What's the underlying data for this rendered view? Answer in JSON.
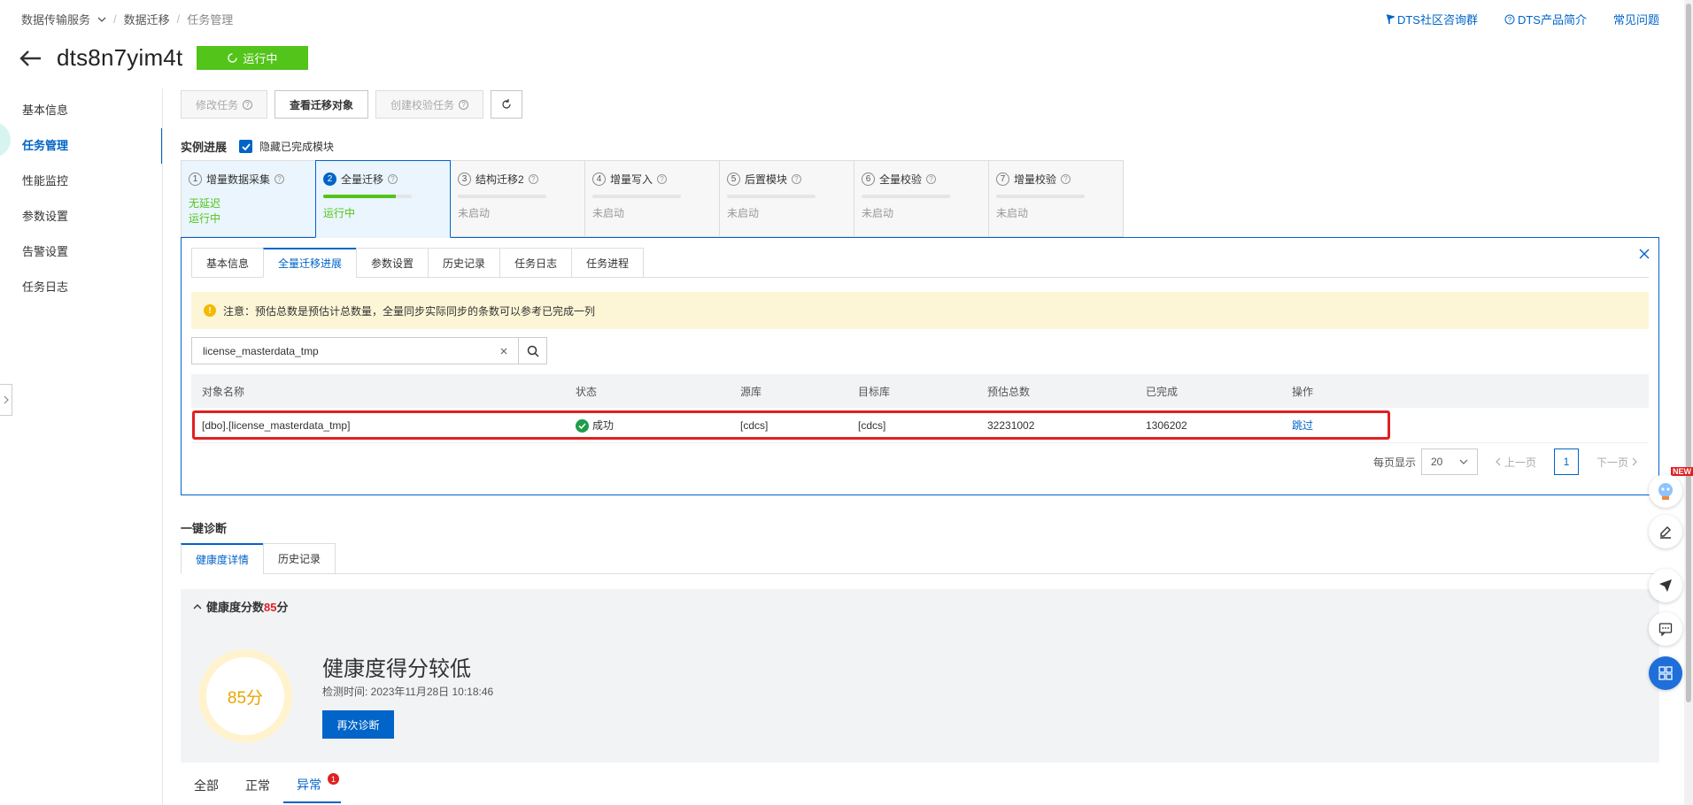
{
  "breadcrumb": {
    "service": "数据传输服务",
    "migrate": "数据迁移",
    "current": "任务管理"
  },
  "top_links": {
    "community": "DTS社区咨询群",
    "intro": "DTS产品简介",
    "faq": "常见问题"
  },
  "header": {
    "title": "dts8n7yim4t",
    "status": "运行中"
  },
  "sidenav": {
    "items": [
      "基本信息",
      "任务管理",
      "性能监控",
      "参数设置",
      "告警设置",
      "任务日志"
    ]
  },
  "toolbar": {
    "modify": "修改任务",
    "view_objects": "查看迁移对象",
    "create_check": "创建校验任务"
  },
  "progress": {
    "label": "实例进展",
    "hide_done": "隐藏已完成模块"
  },
  "steps": [
    {
      "num": "1",
      "name": "增量数据采集",
      "line1": "无延迟",
      "line2": "运行中"
    },
    {
      "num": "2",
      "name": "全量迁移",
      "progress": 0.82,
      "line2": "运行中"
    },
    {
      "num": "3",
      "name": "结构迁移2",
      "status": "未启动"
    },
    {
      "num": "4",
      "name": "增量写入",
      "status": "未启动"
    },
    {
      "num": "5",
      "name": "后置模块",
      "status": "未启动"
    },
    {
      "num": "6",
      "name": "全量校验",
      "status": "未启动"
    },
    {
      "num": "7",
      "name": "增量校验",
      "status": "未启动"
    }
  ],
  "panel": {
    "tabs": [
      "基本信息",
      "全量迁移进展",
      "参数设置",
      "历史记录",
      "任务日志",
      "任务进程"
    ],
    "notice": "注意：预估总数是预估计总数量，全量同步实际同步的条数可以参考已完成一列",
    "search_value": "license_masterdata_tmp",
    "columns": [
      "对象名称",
      "状态",
      "源库",
      "目标库",
      "预估总数",
      "已完成",
      "操作"
    ],
    "row": {
      "name": "[dbo].[license_masterdata_tmp]",
      "status": "成功",
      "source": "[cdcs]",
      "target": "[cdcs]",
      "estimated": "32231002",
      "completed": "1306202",
      "action": "跳过"
    },
    "pager": {
      "per_page_label": "每页显示",
      "per_page": "20",
      "prev": "上一页",
      "page": "1",
      "next": "下一页"
    }
  },
  "diagnosis": {
    "title": "一键诊断",
    "tabs": [
      "健康度详情",
      "历史记录"
    ],
    "score_label_prefix": "健康度分数",
    "score": "85",
    "score_label_suffix": "分",
    "score_ring": "85分",
    "headline": "健康度得分较低",
    "time": "检测时间: 2023年11月28日 10:18:46",
    "rediagnose": "再次诊断",
    "bottom_tabs": [
      "全部",
      "正常",
      "异常"
    ],
    "abnormal_count": "1"
  },
  "floating": {
    "new_tag": "NEW"
  },
  "colors": {
    "primary": "#0064c8",
    "success": "#52c41a",
    "danger": "#e02020",
    "warning": "#f5b900"
  }
}
